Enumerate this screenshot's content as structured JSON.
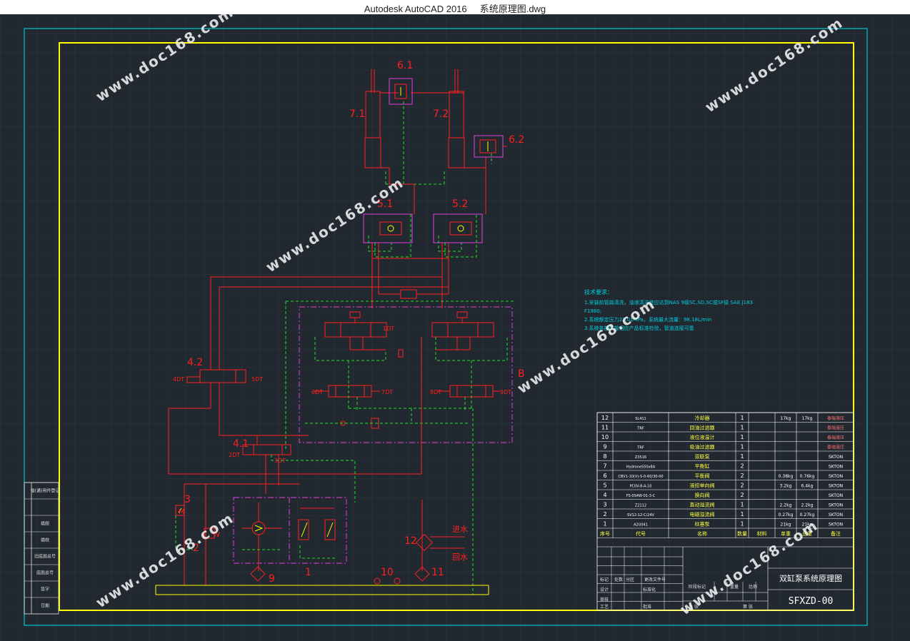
{
  "window": {
    "title": "Autodesk AutoCAD 2016     系统原理图.dwg"
  },
  "colors": {
    "background": "#212830",
    "frame_outer": "#00c8d8",
    "frame_inner": "#ffff00",
    "hydraulic": "#ff2020",
    "pilot": "#20e020",
    "group": "#e040e0",
    "text_tech": "#00d0e0"
  },
  "labels": {
    "v61": "6.1",
    "v62": "6.2",
    "c71": "7.1",
    "c72": "7.2",
    "v51": "5.1",
    "v52": "5.2",
    "v42": "4.2",
    "v41": "4.1",
    "p3": "3",
    "p2": "2",
    "p12": "12",
    "p10": "10",
    "p11": "11",
    "p9": "9",
    "p1": "1",
    "blockB": "B",
    "dt1": "1DT",
    "dt2": "2DT",
    "dt3": "3DT",
    "dt4": "4DT",
    "dt5": "5DT",
    "dt6": "6DT",
    "dt7": "7DT",
    "dt8": "8DT",
    "dt9": "9DT",
    "in_water": "进水",
    "out_water": "回水",
    "motor_m": "M",
    "motor_w": "W"
  },
  "tech": {
    "title": "技术要求：",
    "line1": "1.安装前管路清洗，油液清洁度应达到NAS 9级SC,SD,SC或SF级 SAE J183",
    "line2": "F1980;",
    "line3": "2.系统额定压力23.01MPa，系统最大流量：98.18L/min",
    "line4": "3.系统各部件按相应产品标准检验，管道连接可靠"
  },
  "bom": {
    "header": [
      "序号",
      "代号",
      "名称",
      "数量",
      "材料",
      "单重",
      "总重",
      "备注"
    ],
    "rows": [
      [
        "12",
        "SL411",
        "冷却器",
        "1",
        "",
        "17kg",
        "17kg",
        "泰瑞液压"
      ],
      [
        "11",
        "TRF",
        "回油过滤器",
        "1",
        "",
        "",
        "",
        "泰瑞液压"
      ],
      [
        "10",
        "",
        "液位液温计",
        "1",
        "",
        "",
        "",
        "泰瑞液压"
      ],
      [
        "9",
        "TRF",
        "吸油过滤器",
        "1",
        "",
        "",
        "",
        "泰瑞液压"
      ],
      [
        "8",
        "Z3516",
        "双联泵",
        "1",
        "",
        "",
        "",
        "SKTON"
      ],
      [
        "7",
        "HydroneS50x8A",
        "平衡缸",
        "2",
        "",
        "",
        "",
        "SKTON"
      ],
      [
        "6",
        "CBV1-10(V)-S-0-60/30-00",
        "平衡阀",
        "2",
        "",
        "0.38kg",
        "0.76kg",
        "SKTON"
      ],
      [
        "5",
        "PC0V-8-A-10",
        "液控单向阀",
        "2",
        "",
        "3.2kg",
        "6.4kg",
        "SKTON"
      ],
      [
        "4",
        "FS-0S4W-01-3-C",
        "换向阀",
        "2",
        "",
        "",
        "",
        "SKTON"
      ],
      [
        "3",
        "Z2112",
        "直动溢流阀",
        "1",
        "",
        "2.2kg",
        "2.2kg",
        "SKTON"
      ],
      [
        "2",
        "SV12-12-C/24V",
        "电磁溢流阀",
        "1",
        "",
        "0.27kg",
        "0.27kg",
        "SKTON"
      ],
      [
        "1",
        "A2U041",
        "柱塞泵",
        "1",
        "",
        "21kg",
        "21kg",
        "SKTON"
      ]
    ]
  },
  "titleblock": {
    "name": "双缸泵系统原理图",
    "code": "SFXZD-00",
    "fields": {
      "design": "设计",
      "standard": "标准化",
      "review": "审核",
      "process": "工艺",
      "approve": "批准",
      "stage": "阶段标记",
      "weight": "重量",
      "scale": "比例",
      "sheets": "共 张",
      "sheet": "第 张",
      "mark": "标记",
      "count": "处数",
      "zone": "分区",
      "change_doc": "更改文件号",
      "sign": "签名",
      "date": "年月日"
    }
  },
  "left_table": [
    "借(通)用件登记",
    "",
    "描图",
    "描校",
    "旧底图总号",
    "底图总号",
    "签字",
    "日期"
  ],
  "watermark": "www.doc168.com"
}
